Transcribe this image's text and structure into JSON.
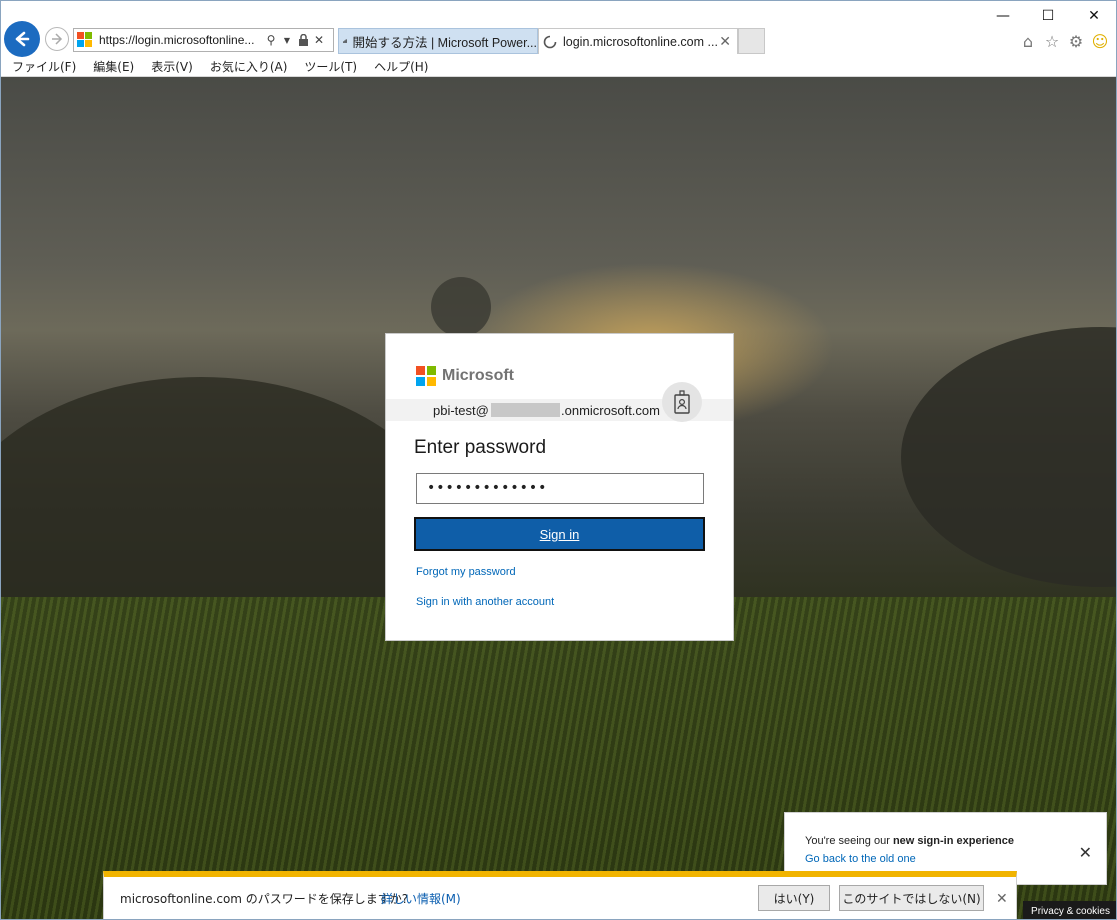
{
  "browser": {
    "url": "https://login.microsoftonline...",
    "tabs": [
      {
        "title": "開始する方法 | Microsoft Power..."
      },
      {
        "title": "login.microsoftonline.com ..."
      }
    ],
    "menu": [
      "ファイル(F)",
      "編集(E)",
      "表示(V)",
      "お気に入り(A)",
      "ツール(T)",
      "ヘルプ(H)"
    ]
  },
  "login": {
    "brand": "Microsoft",
    "user_prefix": "pbi-test@",
    "user_suffix": ".onmicrosoft.com",
    "title": "Enter password",
    "password_mask": "•••••••••••••",
    "signin_label": "Sign in",
    "forgot_link": "Forgot my password",
    "other_account_link": "Sign in with another account"
  },
  "toast": {
    "text_prefix": "You're seeing our ",
    "text_bold": "new sign-in experience",
    "link": "Go back to the old one"
  },
  "footer": {
    "privacy": "Privacy & cookies"
  },
  "notification": {
    "message": "microsoftonline.com のパスワードを保存しますか?",
    "more_info": "詳しい情報(M)",
    "yes_label": "はい(Y)",
    "never_label": "このサイトではしない(N)"
  },
  "colors": {
    "accent": "#0f5ea8",
    "link": "#0067b8",
    "notification_bar": "#f1b400"
  }
}
